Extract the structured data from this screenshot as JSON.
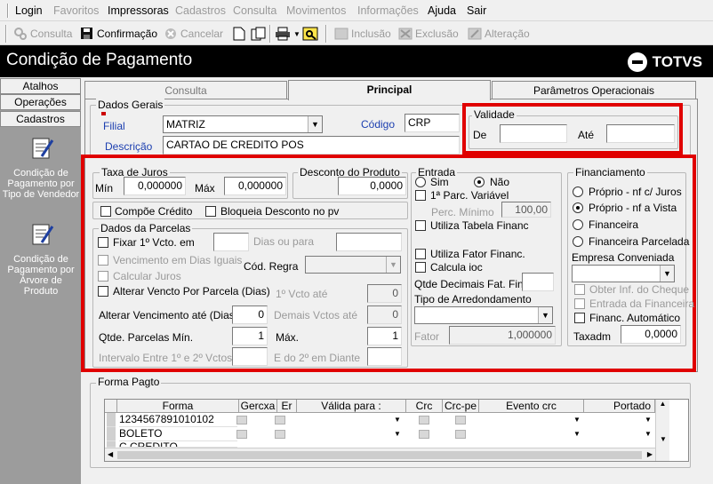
{
  "menu": {
    "items": [
      {
        "label": "Login",
        "enabled": true
      },
      {
        "label": "Favoritos",
        "enabled": false
      },
      {
        "label": "Impressoras",
        "enabled": true
      },
      {
        "label": "Cadastros",
        "enabled": false
      },
      {
        "label": "Consulta",
        "enabled": false
      },
      {
        "label": "Movimentos",
        "enabled": false
      },
      {
        "label": "Informações",
        "enabled": false
      },
      {
        "label": "Ajuda",
        "enabled": true
      },
      {
        "label": "Sair",
        "enabled": true
      }
    ]
  },
  "toolbar": {
    "consulta": "Consulta",
    "confirmacao": "Confirmação",
    "cancelar": "Cancelar",
    "inclusao": "Inclusão",
    "exclusao": "Exclusão",
    "alteracao": "Alteração"
  },
  "title": "Condição de Pagamento",
  "brand": "TOTVS",
  "sidebar": {
    "atalhos": "Atalhos",
    "operacoes": "Operações",
    "cadastros": "Cadastros",
    "items": [
      "Condição de Pagamento por Tipo de Vendedor",
      "Condição de Pagamento por Árvore de Produto"
    ]
  },
  "tabs": {
    "consulta": "Consulta",
    "principal": "Principal",
    "parametros": "Parâmetros Operacionais"
  },
  "dados_gerais": {
    "title": "Dados Gerais",
    "filial_label": "Filial",
    "filial_value": "MATRIZ",
    "codigo_label": "Código",
    "codigo_value": "CRP",
    "descricao_label": "Descrição",
    "descricao_value": "CARTAO DE CREDITO POS"
  },
  "validade": {
    "title": "Validade",
    "de_label": "De",
    "ate_label": "Até",
    "de_value": "",
    "ate_value": ""
  },
  "taxa_juros": {
    "title": "Taxa de Juros",
    "min_label": "Mín",
    "min_value": "0,000000",
    "max_label": "Máx",
    "max_value": "0,000000"
  },
  "desconto": {
    "title": "Desconto do Produto",
    "value": "0,0000"
  },
  "compoe_credito": "Compõe Crédito",
  "bloqueia_desconto": "Bloqueia Desconto no pv",
  "parcelas": {
    "title": "Dados da Parcelas",
    "fixar_label": "Fixar 1º Vcto. em",
    "dias_ou_para": "Dias ou para",
    "venc_dias_iguais": "Vencimento em Dias Iguais",
    "cod_regra": "Cód. Regra",
    "calcular_juros": "Calcular Juros",
    "alterar_vencto": "Alterar Vencto Por Parcela (Dias)",
    "primeiro_vcto_ate": "1º Vcto até",
    "primeiro_vcto_value": "0",
    "alterar_venc_ate": "Alterar Vencimento até (Dias)",
    "alterar_venc_value": "0",
    "demais_vctos": "Demais Vctos até",
    "demais_vctos_value": "0",
    "qtde_min_label": "Qtde. Parcelas Mín.",
    "qtde_min_value": "1",
    "max_label": "Máx.",
    "max_value": "1",
    "intervalo_label": "Intervalo Entre 1º e 2º Vctos.",
    "e_do_2": "E do 2º em Diante"
  },
  "entrada": {
    "title": "Entrada",
    "sim": "Sim",
    "nao": "Não",
    "primeira_parc": "1ª Parc. Variável",
    "perc_minimo": "Perc. Mínimo",
    "perc_minimo_value": "100,00",
    "utiliza_tabela": "Utiliza Tabela Financ",
    "utiliza_fator": "Utiliza Fator Financ.",
    "calcula_ioc": "Calcula ioc",
    "qtde_decimais": "Qtde Decimais Fat. Finan",
    "tipo_arred": "Tipo de Arredondamento",
    "fator_label": "Fator",
    "fator_value": "1,000000"
  },
  "financiamento": {
    "title": "Financiamento",
    "opt1": "Próprio - nf c/ Juros",
    "opt2": "Próprio - nf a Vista",
    "opt3": "Financeira",
    "opt4": "Financeira Parcelada",
    "empresa": "Empresa Conveniada",
    "obter": "Obter Inf. do Cheque",
    "entrada_fin": "Entrada da Financeira",
    "financ_auto": "Financ. Automático",
    "taxadm_label": "Taxadm",
    "taxadm_value": "0,0000"
  },
  "forma_pagto": {
    "title": "Forma Pagto",
    "columns": [
      "Forma",
      "Gercxa",
      "Er",
      "Válida para :",
      "Crc",
      "Crc-pe",
      "Evento crc",
      "Portado"
    ],
    "rows": [
      "1234567891010102",
      "BOLETO",
      "C.CREDITO"
    ]
  },
  "colors": {
    "highlight": "#e00000",
    "titlebar": "#000000",
    "sidebar": "#9c9c9c"
  }
}
